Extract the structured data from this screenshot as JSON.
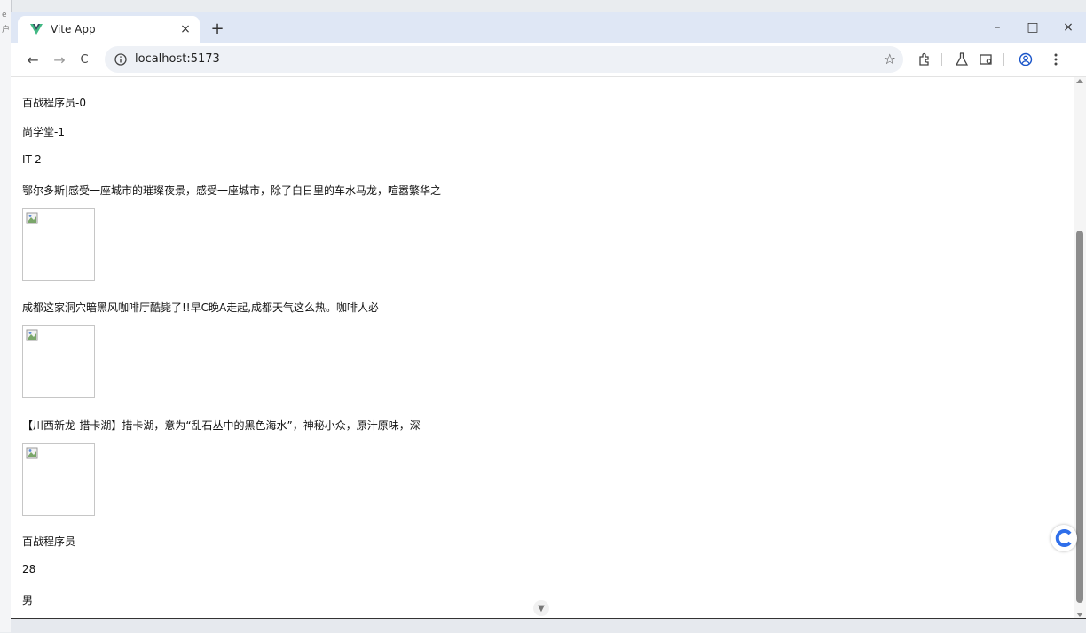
{
  "left_strip": {
    "chars": [
      "e",
      "户"
    ]
  },
  "tab": {
    "title": "Vite App",
    "close": "×"
  },
  "newtab_label": "+",
  "window_controls": {
    "minimize": "–",
    "maximize": "□",
    "close": "×"
  },
  "nav": {
    "back": "←",
    "forward": "→",
    "reload": "C"
  },
  "omnibox": {
    "url": "localhost:5173"
  },
  "content": {
    "lines": [
      "百战程序员-0",
      "尚学堂-1",
      "IT-2",
      "鄂尔多斯|感受一座城市的璀璨夜景，感受一座城市，除了白日里的车水马龙，喧嚣繁华之",
      "成都这家洞穴暗黑风咖啡厅酷毙了!!早C晚A走起,成都天气这么热。咖啡人必",
      "【川西新龙-措卡湖】措卡湖，意为“乱石丛中的黑色海水”，神秘小众，原汁原味，深",
      "百战程序员",
      "28",
      "男"
    ]
  },
  "colors": {
    "tabstrip": "#dfe7f5",
    "omnibox": "#eef1f6",
    "vite_green": "#41b883",
    "vite_dark": "#35495e"
  }
}
